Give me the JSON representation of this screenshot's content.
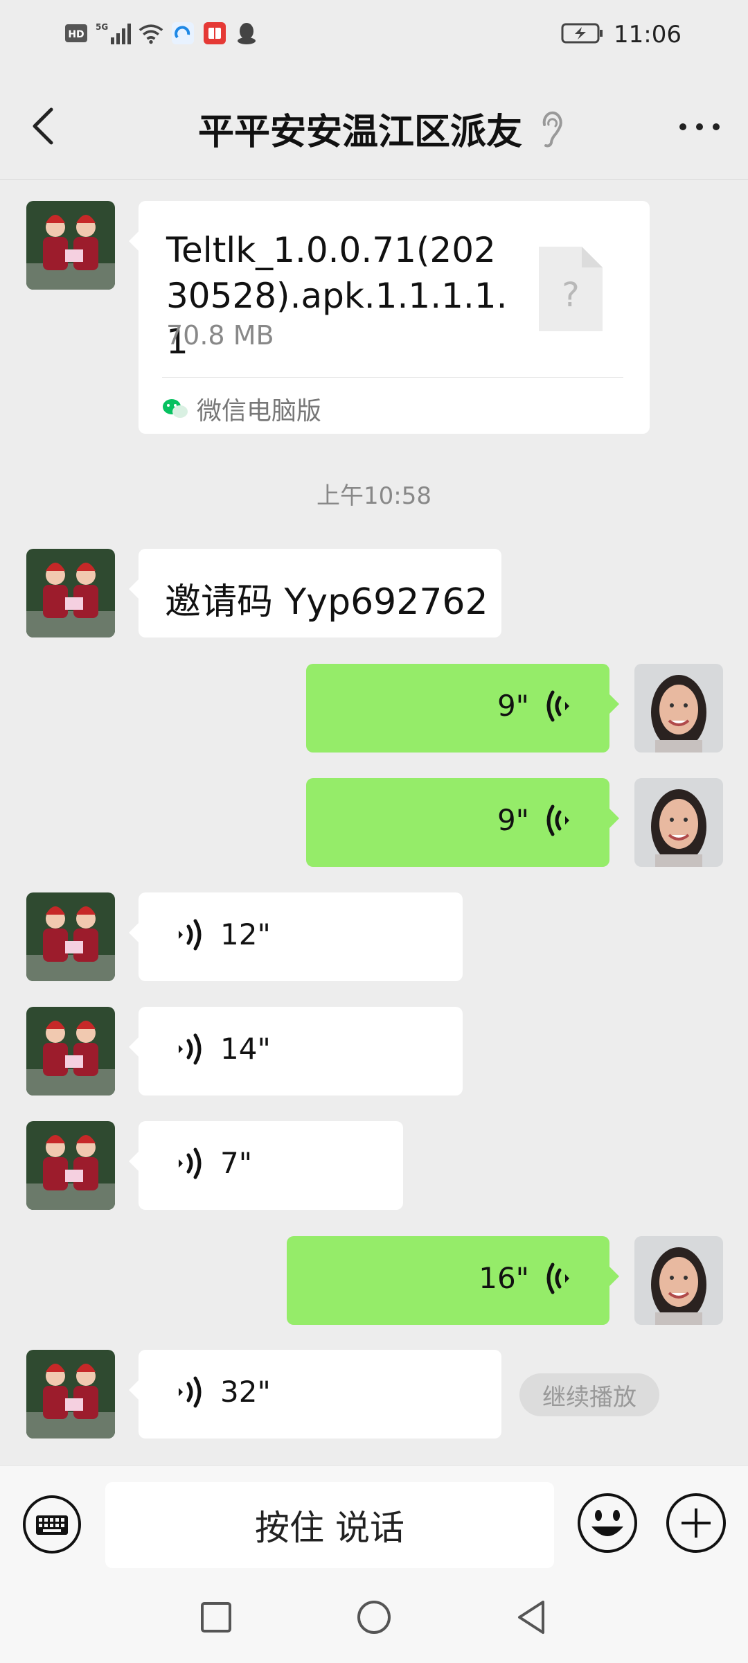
{
  "status_bar": {
    "time": "11:06",
    "hd_label": "HD",
    "network_label": "5G",
    "icons": [
      "hd-icon",
      "signal-icon",
      "wifi-icon",
      "app-icon-blue",
      "app-icon-red",
      "qq-icon",
      "battery-charging-icon"
    ]
  },
  "header": {
    "title": "平平安安温江区派友",
    "icons": [
      "back-icon",
      "ear-icon",
      "more-icon"
    ]
  },
  "messages": {
    "file": {
      "name": "Teltlk_1.0.0.71(20230528).apk.1.1.1.1.1",
      "size": "70.8 MB",
      "source": "微信电脑版",
      "icon_placeholder": "?"
    },
    "timestamp": "上午10:58",
    "invite_text": "邀请码 Yyp692762",
    "voice_out_1": "9\"",
    "voice_out_2": "9\"",
    "voice_in_1": "12\"",
    "voice_in_2": "14\"",
    "voice_in_3": "7\"",
    "voice_out_3": "16\"",
    "voice_in_4": "32\"",
    "continue_label": "继续播放"
  },
  "input_bar": {
    "talk_label": "按住 说话",
    "icons": [
      "keyboard-icon",
      "emoji-icon",
      "plus-icon"
    ]
  },
  "colors": {
    "background": "#ededed",
    "bubble_green": "#95ec69",
    "bubble_white": "#ffffff",
    "wechat_green": "#07c160"
  }
}
